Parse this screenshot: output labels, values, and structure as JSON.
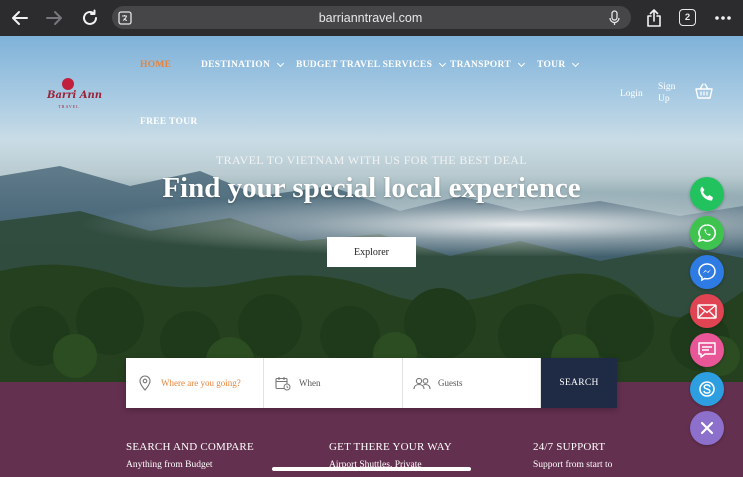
{
  "browser": {
    "url": "barrianntravel.com",
    "tab_count": "2"
  },
  "site": {
    "logo_text": "Barri Ann",
    "logo_sub": "TRAVEL"
  },
  "nav": {
    "items": [
      {
        "label": "HOME",
        "active": true
      },
      {
        "label": "DESTINATION",
        "dropdown": true
      },
      {
        "label": "BUDGET TRAVEL SERVICES",
        "dropdown": true
      },
      {
        "label": "TRANSPORT",
        "dropdown": true
      },
      {
        "label": "TOUR",
        "dropdown": true
      },
      {
        "label": "FREE TOUR"
      }
    ],
    "login": "Login",
    "signup": "Sign Up"
  },
  "hero": {
    "kicker": "TRAVEL TO VIETNAM WITH US FOR THE BEST DEAL",
    "headline": "Find your special local experience",
    "button": "Explorer"
  },
  "search": {
    "where_placeholder": "Where are you going?",
    "when_placeholder": "When",
    "guests_placeholder": "Guests",
    "button": "SEARCH"
  },
  "features": [
    {
      "title": "SEARCH AND COMPARE",
      "text": "Anything from Budget"
    },
    {
      "title": "GET THERE YOUR WAY",
      "text": "Airport Shuttles, Private"
    },
    {
      "title": "24/7 SUPPORT",
      "text": "Support from start to"
    }
  ],
  "contact_buttons": [
    {
      "icon": "phone-icon",
      "color": "#22c35e"
    },
    {
      "icon": "whatsapp-icon",
      "color": "#3ec34f"
    },
    {
      "icon": "messenger-icon",
      "color": "#2e7be4"
    },
    {
      "icon": "email-icon",
      "color": "#e04452"
    },
    {
      "icon": "sms-icon",
      "color": "#e95698"
    },
    {
      "icon": "skype-icon",
      "color": "#2d9fe0"
    },
    {
      "icon": "close-icon",
      "color": "#8c70cc"
    }
  ],
  "colors": {
    "accent": "#e7843b",
    "band": "#64304f",
    "search_button": "#1f2a44"
  }
}
